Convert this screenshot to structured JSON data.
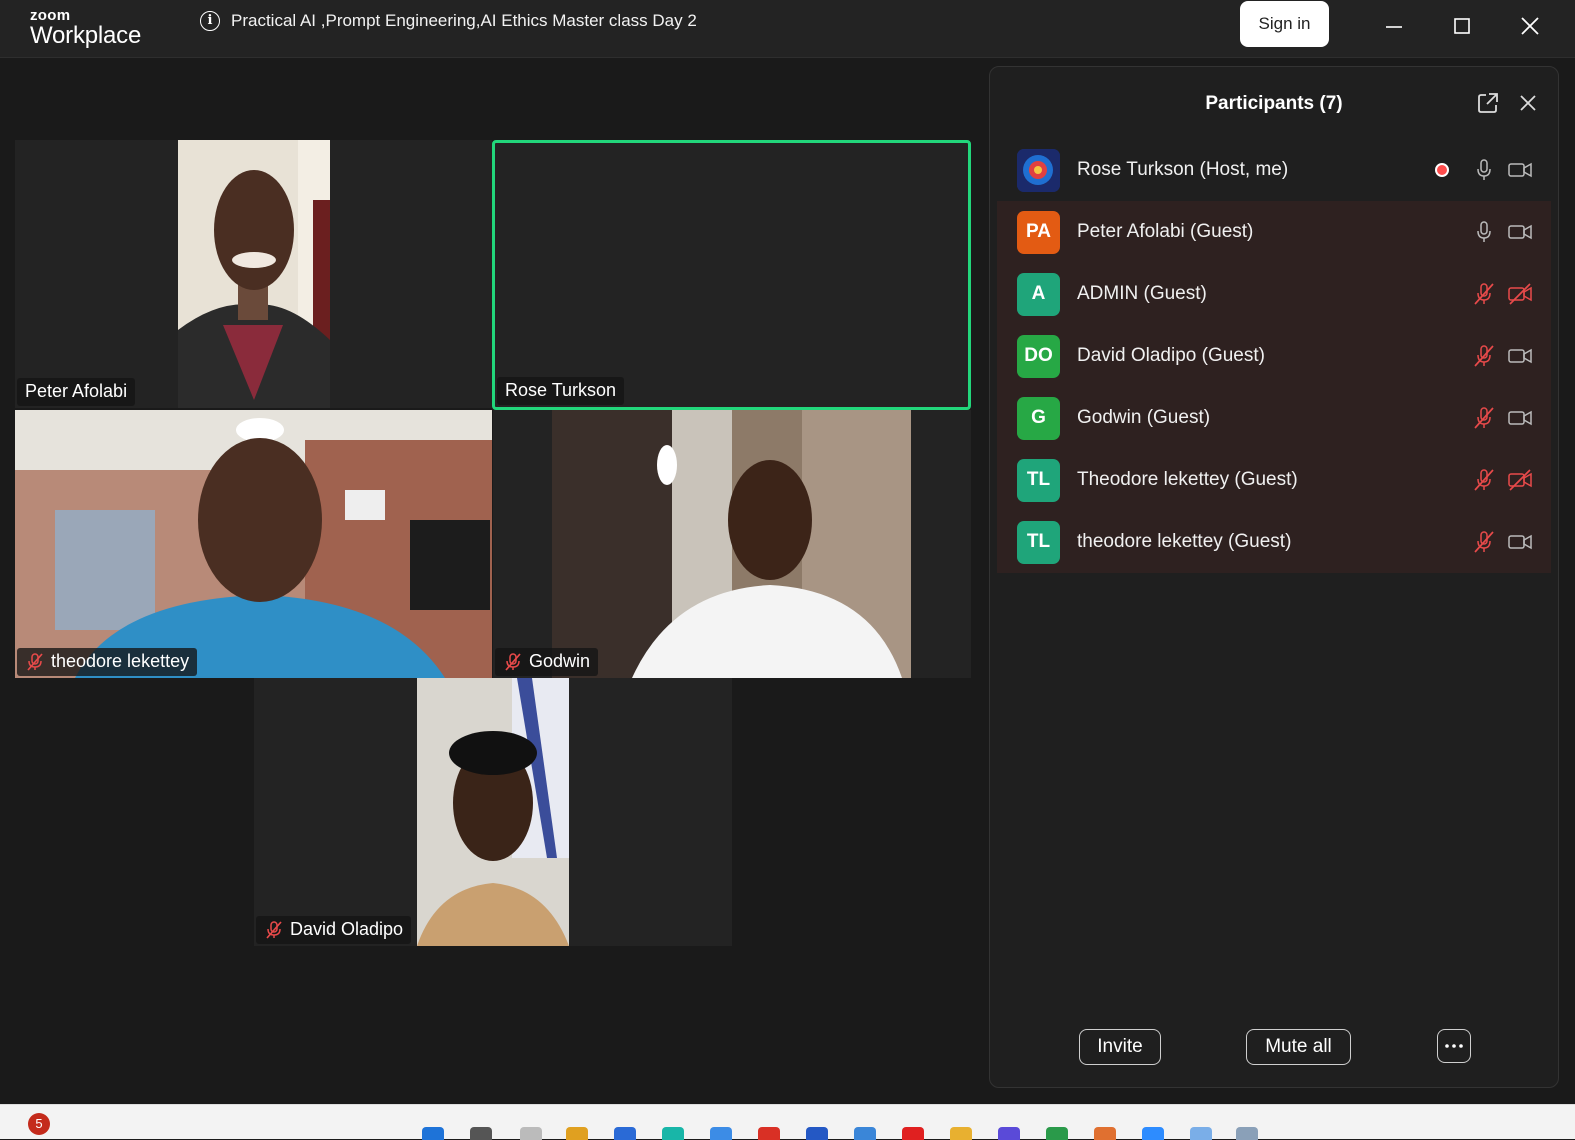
{
  "app": {
    "brand_small": "zoom",
    "brand_big": "Workplace",
    "meeting_title": "Practical AI ,Prompt Engineering,AI Ethics Master class Day 2",
    "info_glyph": "i",
    "sign_in_label": "Sign in"
  },
  "gallery": {
    "tiles": [
      {
        "name": "Peter Afolabi",
        "muted": false,
        "video": true
      },
      {
        "name": "Rose Turkson",
        "muted": false,
        "video": false,
        "active_speaker": true
      },
      {
        "name": "theodore lekettey",
        "muted": true,
        "video": true
      },
      {
        "name": "Godwin",
        "muted": true,
        "video": true
      },
      {
        "name": "David Oladipo",
        "muted": true,
        "video": true
      }
    ]
  },
  "participants": {
    "title": "Participants (7)",
    "list": [
      {
        "name": "Rose Turkson (Host, me)",
        "initials": "",
        "avatar_color": "#1b2a6b",
        "recording": true,
        "mic": "on",
        "camera": "on"
      },
      {
        "name": "Peter Afolabi (Guest)",
        "initials": "PA",
        "avatar_color": "#e35b13",
        "mic": "on",
        "camera": "on"
      },
      {
        "name": "ADMIN (Guest)",
        "initials": "A",
        "avatar_color": "#1fa57a",
        "mic": "muted",
        "camera": "off"
      },
      {
        "name": "David Oladipo (Guest)",
        "initials": "DO",
        "avatar_color": "#27a845",
        "mic": "muted",
        "camera": "on"
      },
      {
        "name": "Godwin (Guest)",
        "initials": "G",
        "avatar_color": "#27a845",
        "mic": "muted",
        "camera": "on"
      },
      {
        "name": "Theodore lekettey (Guest)",
        "initials": "TL",
        "avatar_color": "#1fa57a",
        "mic": "muted",
        "camera": "off"
      },
      {
        "name": "theodore lekettey (Guest)",
        "initials": "TL",
        "avatar_color": "#1fa57a",
        "mic": "muted",
        "camera": "on"
      }
    ],
    "invite_label": "Invite",
    "mute_all_label": "Mute all"
  },
  "taskbar": {
    "notification_count": "5"
  },
  "colors": {
    "active_speaker_border": "#22d67b",
    "muted_red": "#e84a4a",
    "guest_row_bg": "#2e2120",
    "panel_bg": "#1f1f1f"
  }
}
